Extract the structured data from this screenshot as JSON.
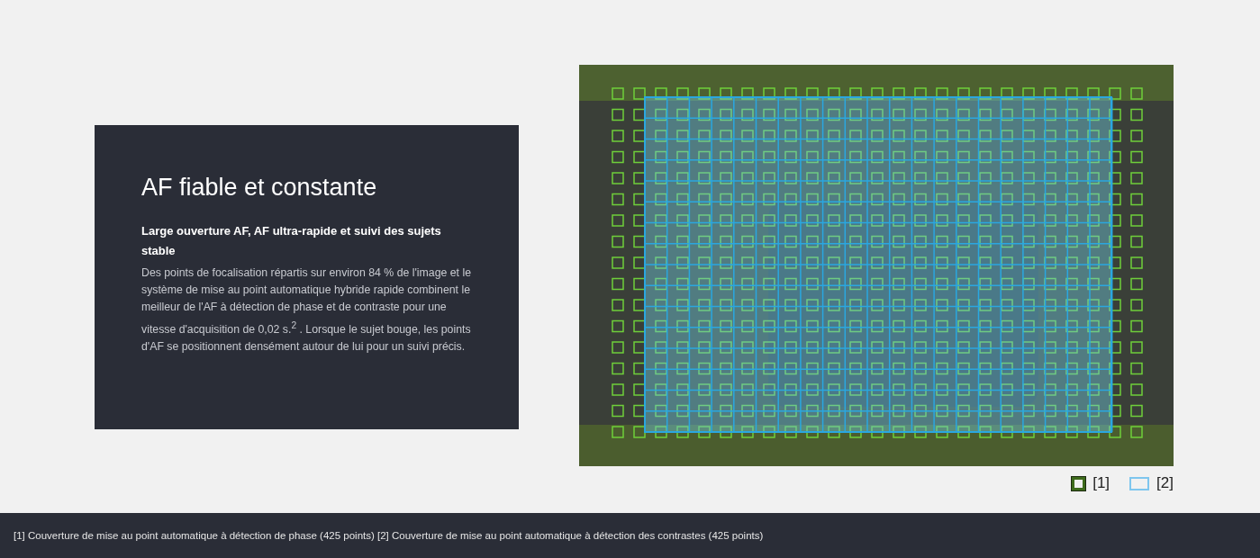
{
  "feature": {
    "title": "AF fiable et constante",
    "subtitle": "Large ouverture AF, AF ultra-rapide et suivi des sujets stable",
    "body": "Des points de focalisation répartis sur environ 84 % de l'image et le système de mise au point automatique hybride rapide combinent le meilleur de l'AF à détection de phase et de contraste pour une vitesse d'acquisition de 0,02 s.$^{2}$ . Lorsque le sujet bouge, les points d'AF se positionnent densément autour de lui pour un suivi précis."
  },
  "legend": [
    {
      "kind": "phase",
      "label": "[1]"
    },
    {
      "kind": "contrast",
      "label": "[2]"
    }
  ],
  "footnote": "[1] Couverture de mise au point automatique à détection de phase (425 points) [2] Couverture de mise au point automatique à détection des contrastes (425 points)"
}
